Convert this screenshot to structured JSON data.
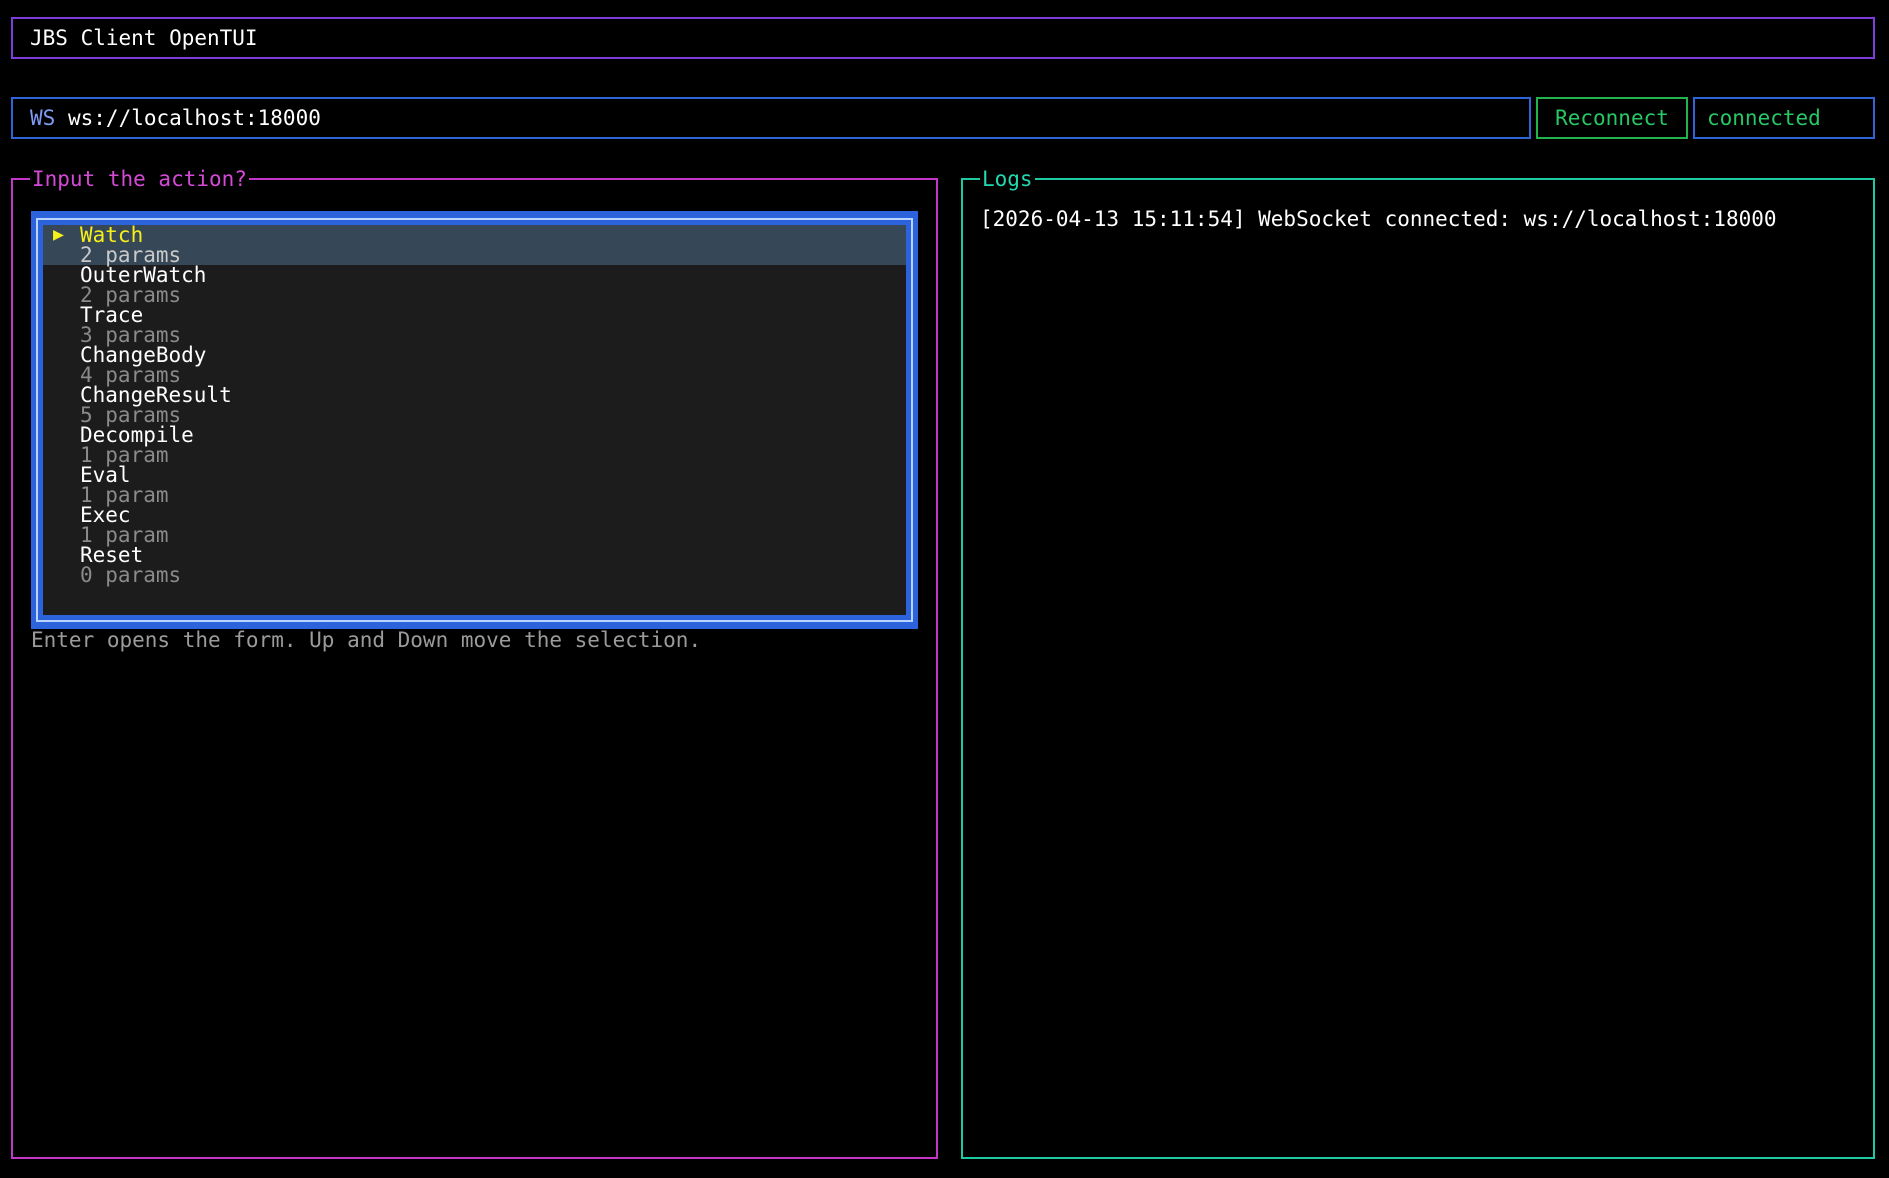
{
  "header": {
    "title": "JBS Client OpenTUI"
  },
  "connection": {
    "label": "WS",
    "url": "ws://localhost:18000",
    "reconnect_label": "Reconnect",
    "status": "connected"
  },
  "actions_panel": {
    "title": "Input the action?",
    "selected_marker": "▶",
    "items": [
      {
        "name": "Watch",
        "params": "2 params",
        "selected": true
      },
      {
        "name": "OuterWatch",
        "params": "2 params"
      },
      {
        "name": "Trace",
        "params": "3 params"
      },
      {
        "name": "ChangeBody",
        "params": "4 params"
      },
      {
        "name": "ChangeResult",
        "params": "5 params"
      },
      {
        "name": "Decompile",
        "params": "1 param"
      },
      {
        "name": "Eval",
        "params": "1 param"
      },
      {
        "name": "Exec",
        "params": "1 param"
      },
      {
        "name": "Reset",
        "params": "0 params"
      }
    ],
    "hint": "Enter opens the form. Up and Down move the selection."
  },
  "logs_panel": {
    "title": "Logs",
    "lines": [
      "[2026-04-13 15:11:54] WebSocket connected: ws://localhost:18000"
    ]
  },
  "colors": {
    "title_border": "#7d3cdc",
    "ws_border": "#2f63d6",
    "reconnect": "#26c764",
    "left_panel": "#c337c8",
    "logs_panel": "#1cc9a0",
    "selection_highlight": "#f5f01a",
    "list_frame": "#2c62dc"
  }
}
